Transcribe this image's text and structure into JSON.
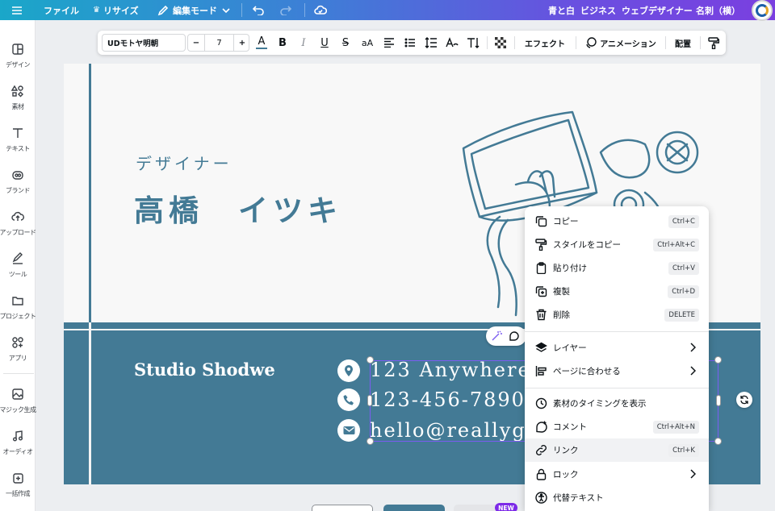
{
  "topbar": {
    "file": "ファイル",
    "resize": "リサイズ",
    "edit_mode": "編集モード",
    "breadcrumbs": [
      "青と白",
      "ビジネス",
      "ウェブデザイナー",
      "名刺（横）"
    ]
  },
  "sidebar": {
    "items": [
      {
        "label": "デザイン",
        "icon": "layout-icon"
      },
      {
        "label": "素材",
        "icon": "elements-icon"
      },
      {
        "label": "テキスト",
        "icon": "text-icon"
      },
      {
        "label": "ブランド",
        "icon": "brand-icon"
      },
      {
        "label": "アップロード",
        "icon": "upload-icon"
      },
      {
        "label": "ツール",
        "icon": "pen-icon"
      },
      {
        "label": "プロジェクト",
        "icon": "folder-icon"
      },
      {
        "label": "アプリ",
        "icon": "apps-icon"
      },
      {
        "label": "マジック生成",
        "icon": "magic-image-icon"
      },
      {
        "label": "オーディオ",
        "icon": "music-icon"
      },
      {
        "label": "一括作成",
        "icon": "bulk-create-icon"
      }
    ]
  },
  "toolbar": {
    "font": "UDモトヤ明朝",
    "size_minus": "−",
    "font_size": "7",
    "size_plus": "+",
    "text_color_glyph": "A",
    "bold": "B",
    "italic": "I",
    "underline": "U",
    "strike": "S",
    "case": "aA",
    "effects": "エフェクト",
    "animation": "アニメーション",
    "position": "配置"
  },
  "card": {
    "role": "デザイナー",
    "name": "高橋　イツキ",
    "studio": "Studio Shodwe",
    "address": "123 Anywhere",
    "phone": "123-456-7890",
    "email": "hello@reallygr",
    "colors": {
      "primary": "#437a95",
      "background": "#f8f8f8"
    }
  },
  "context_menu": {
    "items": [
      {
        "label": "コピー",
        "shortcut": "Ctrl+C",
        "icon": "copy-icon"
      },
      {
        "label": "スタイルをコピー",
        "shortcut": "Ctrl+Alt+C",
        "icon": "paint-roller-icon"
      },
      {
        "label": "貼り付け",
        "shortcut": "Ctrl+V",
        "icon": "clipboard-icon"
      },
      {
        "label": "複製",
        "shortcut": "Ctrl+D",
        "icon": "duplicate-icon"
      },
      {
        "label": "削除",
        "shortcut": "DELETE",
        "icon": "trash-icon"
      },
      {
        "label": "レイヤー",
        "icon": "layers-icon"
      },
      {
        "label": "ページに合わせる",
        "icon": "align-page-icon"
      },
      {
        "label": "素材のタイミングを表示",
        "icon": "clock-icon"
      },
      {
        "label": "コメント",
        "shortcut": "Ctrl+Alt+N",
        "icon": "comment-add-icon"
      },
      {
        "label": "リンク",
        "shortcut": "Ctrl+K",
        "icon": "link-icon"
      },
      {
        "label": "ロック",
        "icon": "lock-icon"
      },
      {
        "label": "代替テキスト",
        "icon": "accessibility-icon"
      }
    ]
  },
  "bottom": {
    "new_badge": "NEW"
  }
}
